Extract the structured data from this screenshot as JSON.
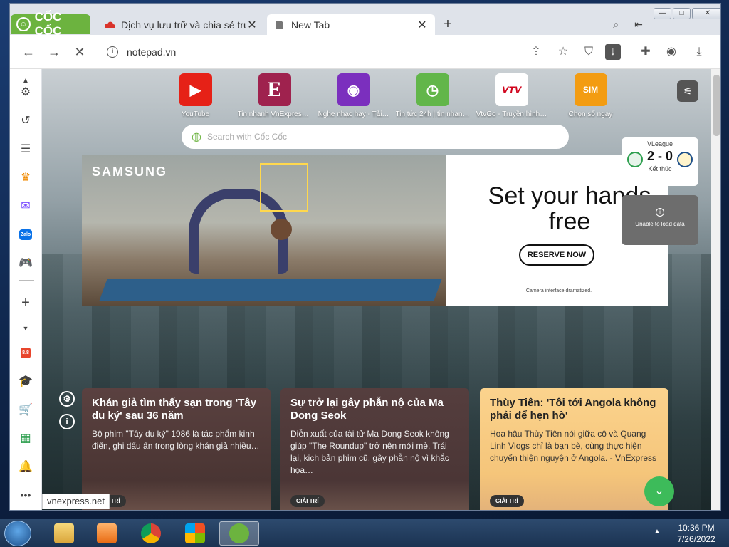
{
  "browser": {
    "brand": "CỐC CỐC",
    "tabs": [
      {
        "title": "Dịch vụ lưu trữ và chia sẻ trực",
        "close": "✕"
      },
      {
        "title": "New Tab",
        "close": "✕"
      }
    ],
    "new_tab": "+",
    "url": "notepad.vn"
  },
  "speed_dial": [
    {
      "label": "YouTube",
      "color": "#e62117",
      "glyph": "▶"
    },
    {
      "label": "Tin nhanh VnExpress…",
      "color": "#9f224e",
      "glyph": "E"
    },
    {
      "label": "Nghe nhạc hay - Tải…",
      "color": "#7b2fbe",
      "glyph": "◉"
    },
    {
      "label": "Tin tức 24h | tin nhan…",
      "color": "#62b64a",
      "glyph": "◷"
    },
    {
      "label": "VtvGo - Truyền hình…",
      "color": "#ffffff",
      "glyph": "VTV"
    },
    {
      "label": "Chọn số ngay",
      "color": "#f39c12",
      "glyph": "SIM"
    }
  ],
  "search": {
    "placeholder": "Search with Cốc Cốc"
  },
  "ad": {
    "brand": "SAMSUNG",
    "headline": "Set your hands free",
    "button": "RESERVE NOW",
    "caption": "Camera interface dramatized."
  },
  "score": {
    "league": "VLeague",
    "result": "2 - 0",
    "status": "Kết thúc"
  },
  "error": {
    "text": "Unable to load data"
  },
  "news": [
    {
      "title": "Khán giả tìm thấy sạn trong 'Tây du ký' sau 36 năm",
      "desc": "Bộ phim \"Tây du ký\" 1986 là tác phẩm kinh điển, ghi dấu ấn trong lòng khán giả nhiều…",
      "tag": "GIẢI TRÍ"
    },
    {
      "title": "Sự trở lại gây phẫn nộ của Ma Dong Seok",
      "desc": "Diễn xuất của tài tử Ma Dong Seok không giúp \"The Roundup\" trở nên mới mẻ. Trái lại, kịch bản phim cũ, gây phẫn nộ vì khắc họa…",
      "tag": "GIẢI TRÍ"
    },
    {
      "title": "Thùy Tiên: 'Tôi tới Angola không phải để hẹn hò'",
      "desc": "Hoa hậu Thùy Tiên nói giữa cô và Quang Linh Vlogs chỉ là bạn bè, cùng thực hiện chuyến thiện nguyện ở Angola. - VnExpress",
      "tag": "GIẢI TRÍ"
    }
  ],
  "status_bar": "vnexpress.net",
  "clock": {
    "time": "10:36 PM",
    "date": "7/26/2022"
  }
}
